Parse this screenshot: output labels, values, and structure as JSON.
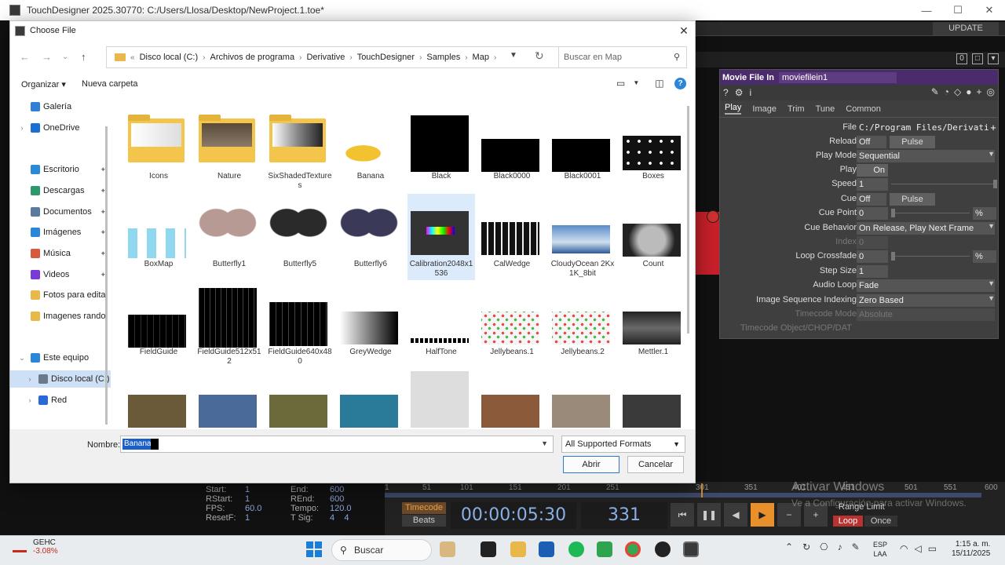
{
  "app": {
    "title": "TouchDesigner 2025.30770: C:/Users/Llosa/Desktop/NewProject.1.toe*",
    "update_label": "UPDATE",
    "frame_count_label": "0"
  },
  "dialog": {
    "title": "Choose File",
    "breadcrumb": [
      "Disco local (C:)",
      "Archivos de programa",
      "Derivative",
      "TouchDesigner",
      "Samples",
      "Map"
    ],
    "breadcrumb_overflow": "«",
    "search_placeholder": "Buscar en Map",
    "organize_label": "Organizar",
    "new_folder_label": "Nueva carpeta",
    "nav_items": [
      {
        "label": "Galería",
        "icon": "gallery-icon",
        "color": "#2f7ed8"
      },
      {
        "label": "OneDrive",
        "icon": "cloud-icon",
        "color": "#1a6fd0"
      },
      {
        "label": "Escritorio",
        "icon": "desktop-icon",
        "color": "#2a8ad8"
      },
      {
        "label": "Descargas",
        "icon": "download-icon",
        "color": "#2a9a6a"
      },
      {
        "label": "Documentos",
        "icon": "document-icon",
        "color": "#5a7aa0"
      },
      {
        "label": "Imágenes",
        "icon": "pictures-icon",
        "color": "#2a86d8"
      },
      {
        "label": "Música",
        "icon": "music-icon",
        "color": "#d85a3a"
      },
      {
        "label": "Videos",
        "icon": "video-icon",
        "color": "#7a3ad8"
      },
      {
        "label": "Fotos para edita",
        "icon": "folder-icon",
        "color": "#e8b84a"
      },
      {
        "label": "Imagenes rando",
        "icon": "folder-icon",
        "color": "#e8b84a"
      },
      {
        "label": "Este equipo",
        "icon": "computer-icon",
        "color": "#2a86d8"
      },
      {
        "label": "Disco local (C:)",
        "icon": "drive-icon",
        "color": "#6a7a8a"
      },
      {
        "label": "Red",
        "icon": "network-icon",
        "color": "#2a6ad8"
      }
    ],
    "files": [
      {
        "name": "Icons",
        "kind": "folder"
      },
      {
        "name": "Nature",
        "kind": "folder"
      },
      {
        "name": "SixShadedTextures",
        "kind": "folder"
      },
      {
        "name": "Banana",
        "kind": "image"
      },
      {
        "name": "Black",
        "kind": "image"
      },
      {
        "name": "Black0000",
        "kind": "image"
      },
      {
        "name": "Black0001",
        "kind": "image"
      },
      {
        "name": "Boxes",
        "kind": "image"
      },
      {
        "name": "BoxMap",
        "kind": "image"
      },
      {
        "name": "Butterfly1",
        "kind": "image"
      },
      {
        "name": "Butterfly5",
        "kind": "image"
      },
      {
        "name": "Butterfly6",
        "kind": "image"
      },
      {
        "name": "Calibration2048x1536",
        "kind": "image"
      },
      {
        "name": "CalWedge",
        "kind": "image"
      },
      {
        "name": "CloudyOcean 2Kx1K_8bit",
        "kind": "image"
      },
      {
        "name": "Count",
        "kind": "image"
      },
      {
        "name": "FieldGuide",
        "kind": "image"
      },
      {
        "name": "FieldGuide512x512",
        "kind": "image"
      },
      {
        "name": "FieldGuide640x480",
        "kind": "image"
      },
      {
        "name": "GreyWedge",
        "kind": "image"
      },
      {
        "name": "HalfTone",
        "kind": "image"
      },
      {
        "name": "Jellybeans.1",
        "kind": "image"
      },
      {
        "name": "Jellybeans.2",
        "kind": "image"
      },
      {
        "name": "Mettler.1",
        "kind": "image"
      }
    ],
    "file_name_label": "Nombre:",
    "file_name_value": "Banana",
    "format_value": "All Supported Formats",
    "open_label": "Abrir",
    "cancel_label": "Cancelar"
  },
  "params": {
    "op_type": "Movie File In",
    "op_name": "moviefilein1",
    "tabs": [
      "Play",
      "Image",
      "Trim",
      "Tune",
      "Common"
    ],
    "rows": [
      {
        "label": "File",
        "value": "C:/Program Files/Derivati"
      },
      {
        "label": "Reload",
        "value": "Off",
        "button": "Pulse"
      },
      {
        "label": "Play Mode",
        "value": "Sequential"
      },
      {
        "label": "Play",
        "value": "On"
      },
      {
        "label": "Speed",
        "value": "1"
      },
      {
        "label": "Cue",
        "value": "Off",
        "button": "Pulse"
      },
      {
        "label": "Cue Point",
        "value": "0",
        "unit": "%"
      },
      {
        "label": "Cue Behavior",
        "value": "On Release, Play Next Frame"
      },
      {
        "label": "Index",
        "value": "0"
      },
      {
        "label": "Loop Crossfade",
        "value": "0",
        "unit": "%"
      },
      {
        "label": "Step Size",
        "value": "1"
      },
      {
        "label": "Audio Loop",
        "value": "Fade"
      },
      {
        "label": "Image Sequence Indexing",
        "value": "Zero Based"
      },
      {
        "label": "Timecode Mode",
        "value": "Absolute"
      },
      {
        "label": "Timecode Object/CHOP/DAT",
        "value": ""
      }
    ]
  },
  "timeline": {
    "ruler": [
      "1",
      "51",
      "101",
      "151",
      "201",
      "251",
      "301",
      "351",
      "401",
      "451",
      "501",
      "551",
      "600"
    ],
    "stats": [
      {
        "label": "Start:",
        "value": "1"
      },
      {
        "label": "RStart:",
        "value": "1"
      },
      {
        "label": "FPS:",
        "value": "60.0"
      },
      {
        "label": "ResetF:",
        "value": "1"
      },
      {
        "label": "End:",
        "value": "600"
      },
      {
        "label": "REnd:",
        "value": "600"
      },
      {
        "label": "Tempo:",
        "value": "120.0"
      },
      {
        "label": "T Sig:",
        "value": "4    4"
      }
    ],
    "timecode_label": "Timecode",
    "beats_label": "Beats",
    "timecode": "00:00:05:30",
    "frame": "331",
    "range_limit": "Range Limit",
    "loop_label": "Loop",
    "once_label": "Once"
  },
  "watermark": {
    "line1": "Activar Windows",
    "line2": "Ve a Configuración para activar Windows."
  },
  "taskbar": {
    "stock_name": "GEHC",
    "stock_change": "-3.08%",
    "search_label": "Buscar",
    "lang_line1": "ESP",
    "lang_line2": "LAA",
    "time": "1:15 a. m.",
    "date": "15/11/2025"
  }
}
